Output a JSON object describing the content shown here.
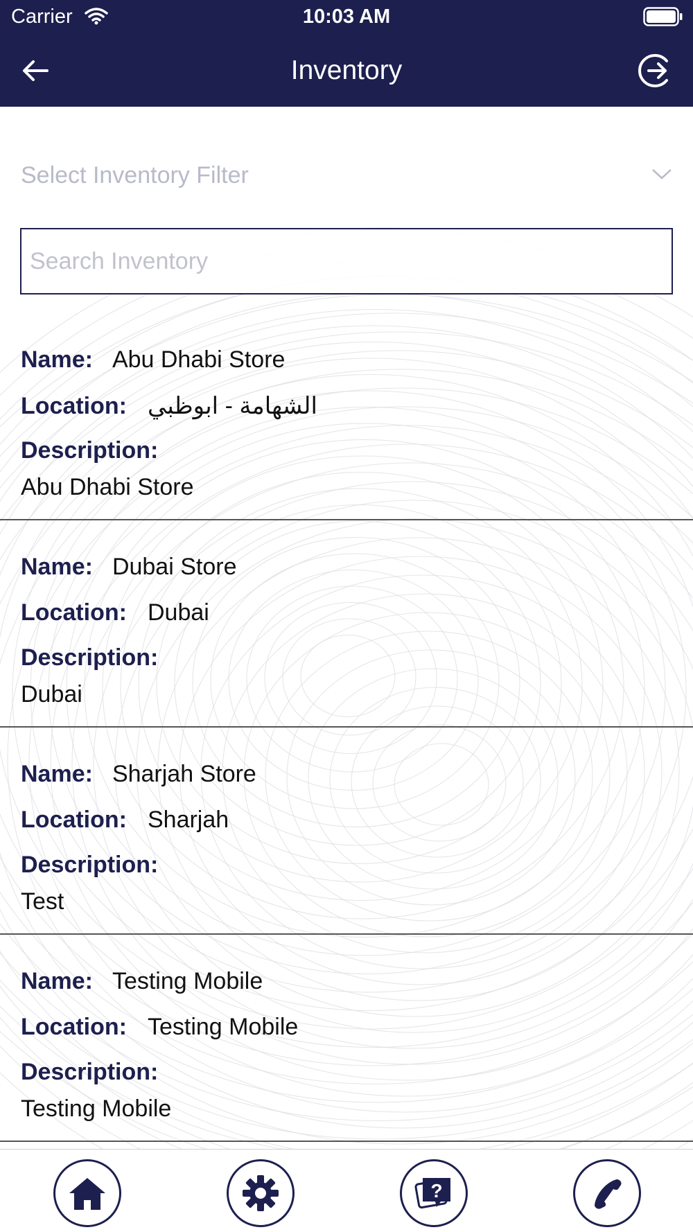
{
  "status_bar": {
    "carrier": "Carrier",
    "time": "10:03 AM"
  },
  "header": {
    "title": "Inventory"
  },
  "filter": {
    "placeholder": "Select Inventory Filter"
  },
  "search": {
    "placeholder": "Search Inventory"
  },
  "labels": {
    "name": "Name:",
    "location": "Location:",
    "description": "Description:"
  },
  "items": [
    {
      "name": "Abu Dhabi Store",
      "location": "الشهامة - ابوظبي",
      "description": "Abu Dhabi Store"
    },
    {
      "name": "Dubai Store",
      "location": "Dubai",
      "description": "Dubai"
    },
    {
      "name": "Sharjah Store",
      "location": "Sharjah",
      "description": "Test"
    },
    {
      "name": "Testing Mobile",
      "location": "Testing Mobile",
      "description": "Testing Mobile"
    }
  ],
  "tabbar": {
    "icons": [
      "home-icon",
      "gear-icon",
      "help-icon",
      "phone-icon"
    ]
  },
  "colors": {
    "primary": "#1d1f4e",
    "background": "#ffffff",
    "placeholder": "#b8bac8"
  }
}
